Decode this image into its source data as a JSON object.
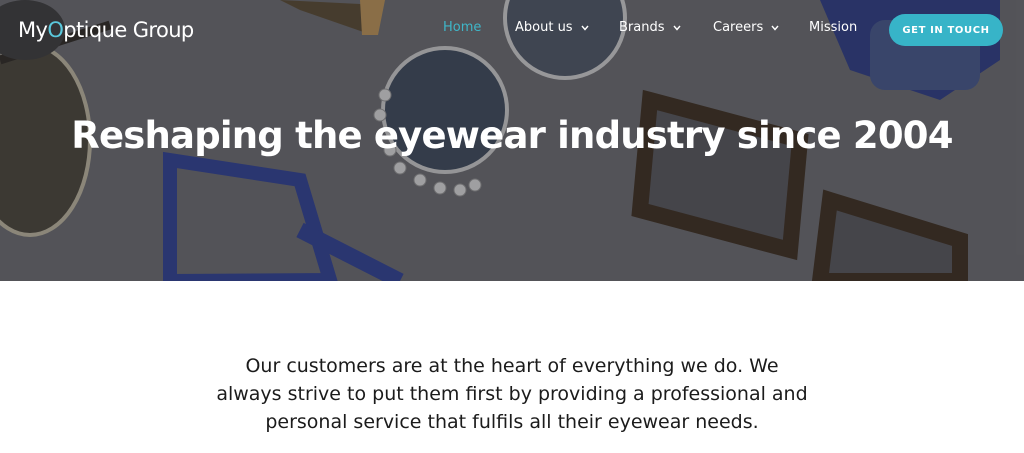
{
  "header": {
    "logo": {
      "part1": "My",
      "accent": "O",
      "part2": "ptique Group"
    },
    "nav": [
      {
        "label": "Home",
        "active": true,
        "dropdown": false
      },
      {
        "label": "About us",
        "active": false,
        "dropdown": true
      },
      {
        "label": "Brands",
        "active": false,
        "dropdown": true
      },
      {
        "label": "Careers",
        "active": false,
        "dropdown": true
      },
      {
        "label": "Mission",
        "active": false,
        "dropdown": false
      }
    ],
    "cta_label": "GET IN TOUCH"
  },
  "hero": {
    "title": "Reshaping the eyewear industry since 2004",
    "background": "eyeglasses-photo"
  },
  "intro": {
    "text": "Our customers are at the heart of everything we do. We always strive to put them first by providing a professional and personal service that fulfils all their eyewear needs."
  },
  "colors": {
    "accent": "#37b4c8",
    "active_nav": "#3fb6c8",
    "body_text": "#1b1b1b"
  }
}
